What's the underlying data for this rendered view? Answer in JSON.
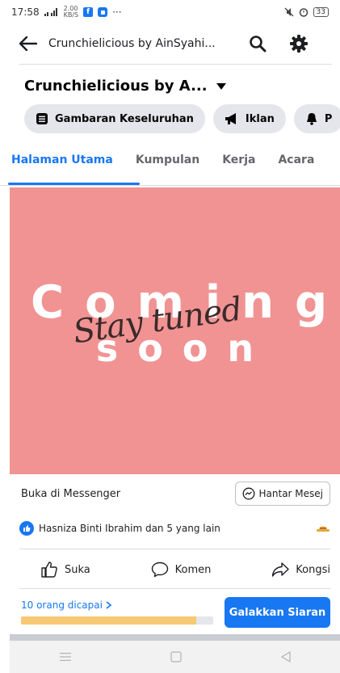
{
  "status_bar": {
    "time": "17:58",
    "net_speed_top": "2.00",
    "net_speed_bottom": "KB/S",
    "fb_letter": "f",
    "more": "···",
    "battery": "33"
  },
  "header": {
    "title": "Crunchielicious by AinSyahi..."
  },
  "page": {
    "name": "Crunchielicious by A..."
  },
  "chips": [
    {
      "label": "Gambaran Keseluruhan",
      "icon": "overview-icon"
    },
    {
      "label": "Iklan",
      "icon": "megaphone-icon"
    },
    {
      "label": "P",
      "icon": "bell-icon"
    }
  ],
  "tabs": [
    {
      "label": "Halaman Utama",
      "active": true
    },
    {
      "label": "Kumpulan",
      "active": false
    },
    {
      "label": "Kerja",
      "active": false
    },
    {
      "label": "Acara",
      "active": false
    }
  ],
  "cover": {
    "line1": "Coming",
    "line2": "soon",
    "script": "Stay tuned",
    "bg_color": "#f19393"
  },
  "messenger": {
    "label": "Buka di Messenger",
    "button": "Hantar Mesej"
  },
  "reactions": {
    "text": "Hasniza Binti Ibrahim dan 5 yang lain"
  },
  "actions": {
    "like": "Suka",
    "comment": "Komen",
    "share": "Kongsi"
  },
  "reach": {
    "text": "10 orang dicapai",
    "progress_fraction": 0.91,
    "boost_button": "Galakkan Siaran"
  },
  "colors": {
    "accent": "#1877f2",
    "progress": "#f7c873"
  }
}
